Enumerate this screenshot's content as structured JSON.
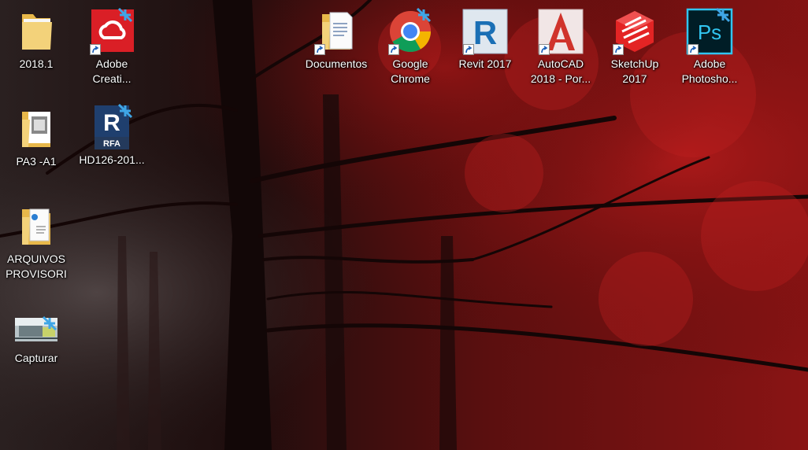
{
  "desktop": {
    "icons": [
      {
        "id": "2018-1",
        "label": "2018.1",
        "icon": "folder-icon"
      },
      {
        "id": "adobe-cc",
        "label": "Adobe\nCreati...",
        "icon": "adobe-creative-cloud-icon"
      },
      {
        "id": "documentos",
        "label": "Documentos",
        "icon": "folder-documents-icon"
      },
      {
        "id": "google-chrome",
        "label": "Google\nChrome",
        "icon": "chrome-icon"
      },
      {
        "id": "revit-2017",
        "label": "Revit 2017",
        "icon": "revit-icon"
      },
      {
        "id": "autocad-2018",
        "label": "AutoCAD\n2018 - Por...",
        "icon": "autocad-icon"
      },
      {
        "id": "sketchup-2017",
        "label": "SketchUp\n2017",
        "icon": "sketchup-icon"
      },
      {
        "id": "adobe-photoshop",
        "label": "Adobe\nPhotosho...",
        "icon": "photoshop-icon"
      },
      {
        "id": "pa3-a1",
        "label": "PA3 -A1",
        "icon": "folder-drawing-icon"
      },
      {
        "id": "hd126",
        "label": "HD126-201...",
        "icon": "revit-family-icon"
      },
      {
        "id": "arquivos-provisori",
        "label": "ARQUIVOS\nPROVISORI",
        "icon": "folder-pdf-icon"
      },
      {
        "id": "capturar",
        "label": "Capturar",
        "icon": "image-thumbnail-icon"
      }
    ],
    "rfa_badge": "RFA",
    "photoshop_letters": "Ps"
  }
}
